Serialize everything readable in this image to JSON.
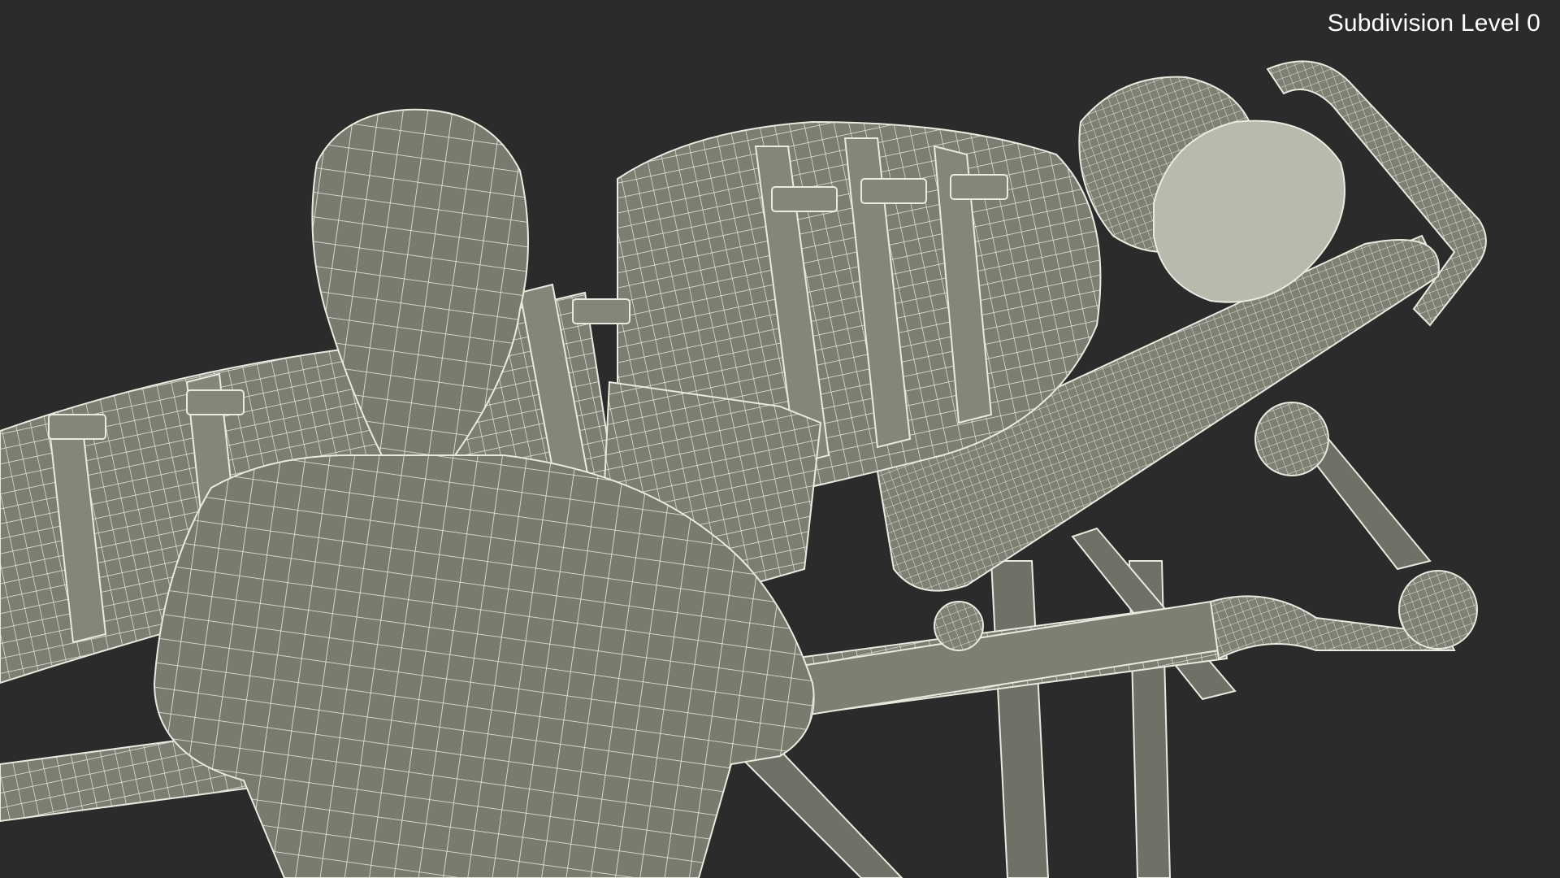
{
  "overlay": {
    "subdivision_label": "Subdivision Level 0"
  },
  "scene": {
    "background_color": "#2b2b2b",
    "mesh_fill_color": "#7d7e72",
    "wire_color": "#e9e9df"
  }
}
